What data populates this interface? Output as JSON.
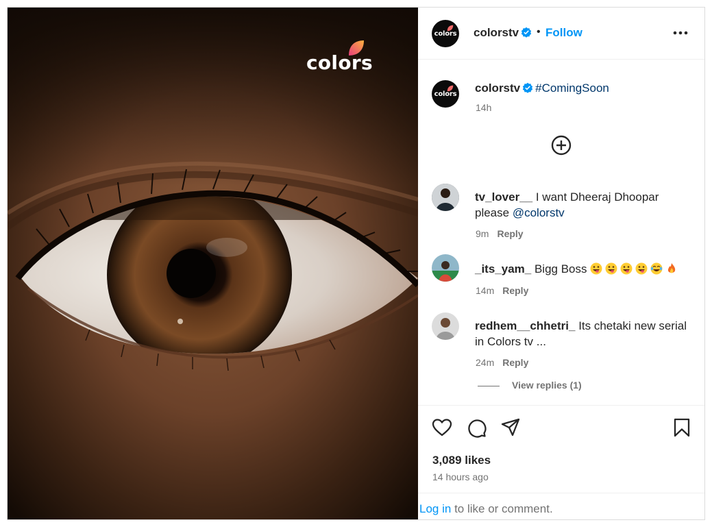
{
  "brand": {
    "logo_text": "colors"
  },
  "header": {
    "username": "colorstv",
    "separator": "•",
    "follow_label": "Follow",
    "more_icon": "more-horizontal-icon"
  },
  "caption": {
    "username": "colorstv",
    "hashtag": "#ComingSoon",
    "time": "14h"
  },
  "comments": [
    {
      "username": "tv_lover__",
      "text": "I want Dheeraj Dhoopar please",
      "mention": "@colorstv",
      "time": "9m",
      "reply_label": "Reply"
    },
    {
      "username": "_its_yam_",
      "text": "Bigg Boss",
      "emojis": [
        "grinning-tongue-emoji",
        "grinning-tongue-emoji",
        "grinning-tongue-emoji",
        "grinning-tongue-emoji",
        "tears-of-joy-emoji",
        "fire-emoji"
      ],
      "time": "14m",
      "reply_label": "Reply"
    },
    {
      "username": "redhem__chhetri_",
      "text": "Its chetaki new serial in Colors tv ...",
      "time": "24m",
      "reply_label": "Reply"
    }
  ],
  "view_replies_label": "View replies (1)",
  "actions": {
    "like_icon": "heart-icon",
    "comment_icon": "comment-icon",
    "share_icon": "send-icon",
    "save_icon": "bookmark-icon"
  },
  "likes_label": "3,089 likes",
  "posted_time": "14 hours ago",
  "login_prompt": {
    "link_label": "Log in",
    "rest_label": "to like or comment."
  },
  "colors": {
    "accent": "#0095f6",
    "link": "#00376b",
    "muted": "#737373",
    "text": "#262626"
  }
}
